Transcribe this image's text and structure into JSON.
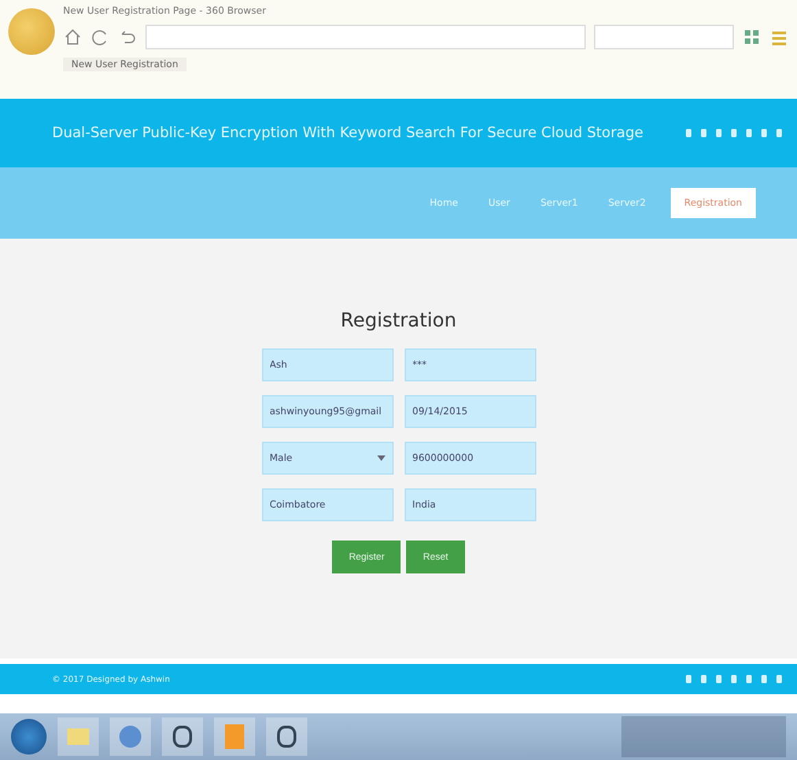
{
  "browser": {
    "title": "New User Registration Page - 360 Browser",
    "tab": "New User Registration"
  },
  "header": {
    "title": "Dual-Server Public-Key Encryption With Keyword Search For Secure Cloud Storage"
  },
  "nav": [
    {
      "label": "Home",
      "selected": false
    },
    {
      "label": "User",
      "selected": false
    },
    {
      "label": "Server1",
      "selected": false
    },
    {
      "label": "Server2",
      "selected": false
    },
    {
      "label": "Registration",
      "selected": true
    }
  ],
  "form": {
    "heading": "Registration",
    "fields": [
      {
        "kind": "text",
        "value": "Ash"
      },
      {
        "kind": "text",
        "value": "***"
      },
      {
        "kind": "text",
        "value": "ashwinyoung95@gmail"
      },
      {
        "kind": "text",
        "value": "09/14/2015"
      },
      {
        "kind": "select",
        "value": "Male"
      },
      {
        "kind": "text",
        "value": "9600000000"
      },
      {
        "kind": "text",
        "value": "Coimbatore"
      },
      {
        "kind": "text",
        "value": "India"
      }
    ],
    "buttons": [
      "Register",
      "Reset"
    ]
  },
  "footer": {
    "copyright": "© 2017 Designed by Ashwin"
  }
}
